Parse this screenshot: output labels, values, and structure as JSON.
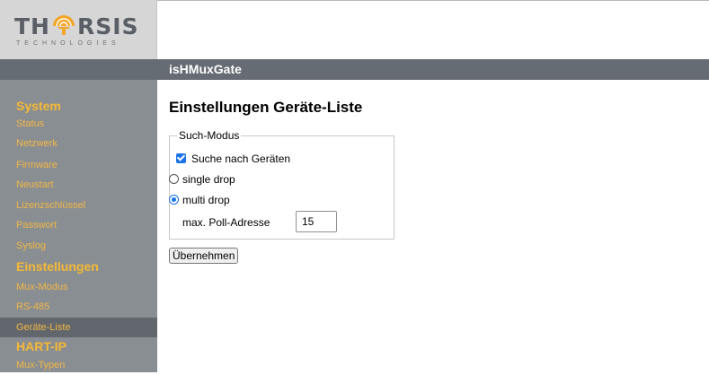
{
  "logo": {
    "brand_text": "THORSIS",
    "brand_left": "TH",
    "brand_right": "RSIS",
    "subtitle": "TECHNOLOGIES"
  },
  "header": {
    "app_title": "isHMuxGate"
  },
  "sidebar": {
    "sections": [
      {
        "label": "System",
        "items": [
          "Status",
          "Netzwerk",
          "Firmware",
          "Neustart",
          "Lizenzschlüssel",
          "Passwort",
          "Syslog"
        ]
      },
      {
        "label": "Einstellungen",
        "items": [
          "Mux-Modus",
          "RS-485",
          "Geräte-Liste"
        ]
      },
      {
        "label": "HART-IP",
        "items": [
          "Mux-Typen"
        ]
      }
    ],
    "active_item": "Geräte-Liste"
  },
  "main": {
    "title": "Einstellungen Geräte-Liste",
    "fieldset_legend": "Such-Modus",
    "search_devices": {
      "label": "Suche nach Geräten",
      "checked": true
    },
    "mode_options": [
      {
        "label": "single drop",
        "selected": false
      },
      {
        "label": "multi drop",
        "selected": true
      }
    ],
    "poll_address": {
      "label": "max. Poll-Adresse",
      "value": "15"
    },
    "apply_label": "Übernehmen"
  },
  "colors": {
    "header_bar": "#666c73",
    "sidebar_bg": "#898e93",
    "sidebar_active": "#62676d",
    "nav_text": "#f6b833",
    "logo_accent": "#f3a628"
  }
}
